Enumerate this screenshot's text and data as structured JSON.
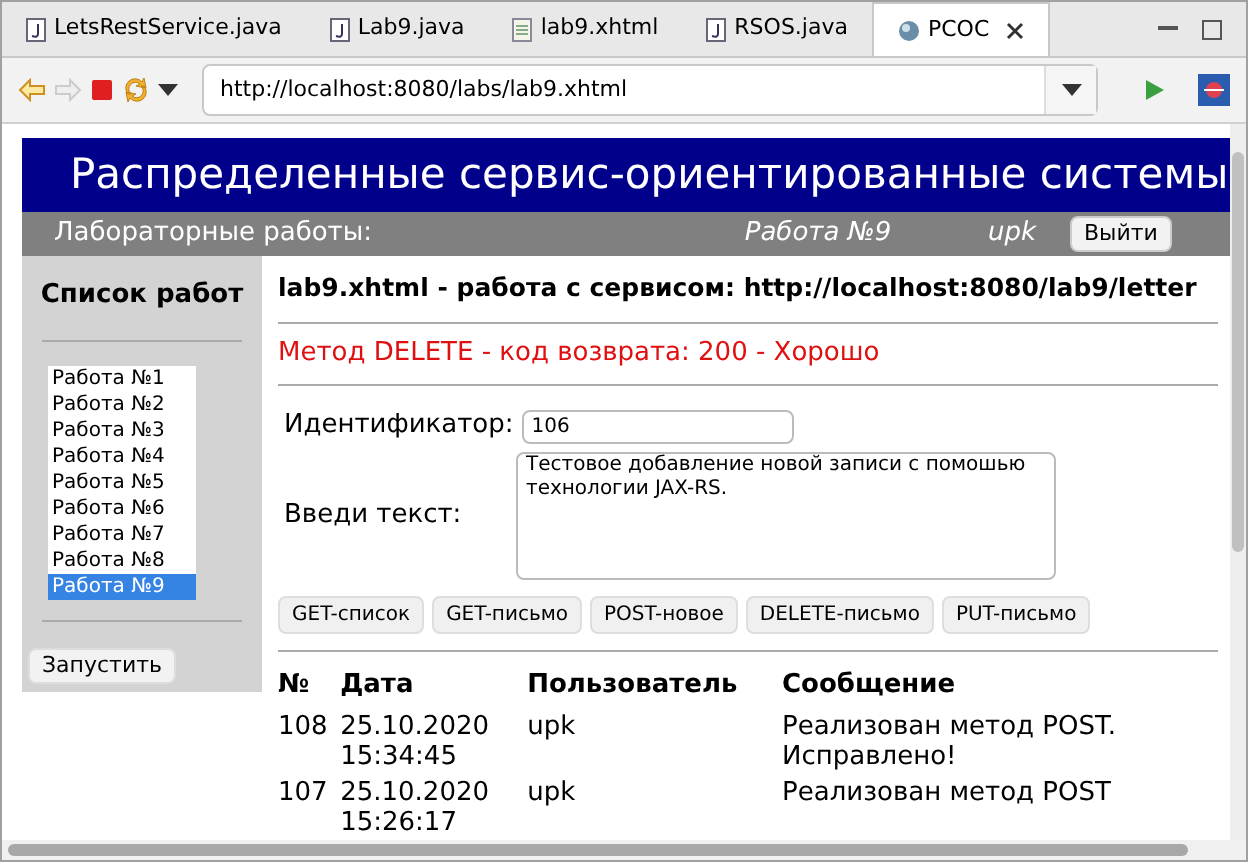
{
  "editor_tabs": [
    {
      "label": "LetsRestService.java",
      "kind": "java",
      "selected": false
    },
    {
      "label": "Lab9.java",
      "kind": "java",
      "selected": false
    },
    {
      "label": "lab9.xhtml",
      "kind": "xhtml",
      "selected": false
    },
    {
      "label": "RSOS.java",
      "kind": "java",
      "selected": false
    },
    {
      "label": "РСОС",
      "kind": "browser",
      "selected": true
    }
  ],
  "toolbar": {
    "url": "http://localhost:8080/labs/lab9.xhtml"
  },
  "page": {
    "header": {
      "title": "Распределенные сервис-ориентированные системы"
    },
    "nav": {
      "label": "Лабораторные работы:",
      "current_work": "Работа №9",
      "user": "upk",
      "logout_button": "Выйти"
    },
    "sidebar": {
      "title": "Список работ",
      "works": [
        {
          "label": "Работа №1",
          "selected": false
        },
        {
          "label": "Работа №2",
          "selected": false
        },
        {
          "label": "Работа №3",
          "selected": false
        },
        {
          "label": "Работа №4",
          "selected": false
        },
        {
          "label": "Работа №5",
          "selected": false
        },
        {
          "label": "Работа №6",
          "selected": false
        },
        {
          "label": "Работа №7",
          "selected": false
        },
        {
          "label": "Работа №8",
          "selected": false
        },
        {
          "label": "Работа №9",
          "selected": true
        }
      ],
      "run_button": "Запустить"
    },
    "main": {
      "heading": "lab9.xhtml - работа с сервисом: http://localhost:8080/lab9/letter",
      "status_message": "Метод DELETE - код возврата: 200 - Хорошо",
      "id_label": "Идентификатор:",
      "id_value": "106",
      "text_label": "Введи текст:",
      "text_value": "Тестовое добавление новой записи с помошью технологии JAX-RS.",
      "buttons": [
        "GET-список",
        "GET-письмо",
        "POST-новое",
        "DELETE-письмо",
        "PUT-письмо"
      ],
      "table": {
        "columns": [
          "№",
          "Дата",
          "Пользователь",
          "Сообщение"
        ],
        "rows": [
          {
            "cells": [
              "108",
              "25.10.2020 15:34:45",
              "upk",
              "Реализован метод POST. Исправлено!"
            ]
          },
          {
            "cells": [
              "107",
              "25.10.2020 15:26:17",
              "upk",
              "Реализован метод POST"
            ]
          }
        ]
      }
    }
  }
}
